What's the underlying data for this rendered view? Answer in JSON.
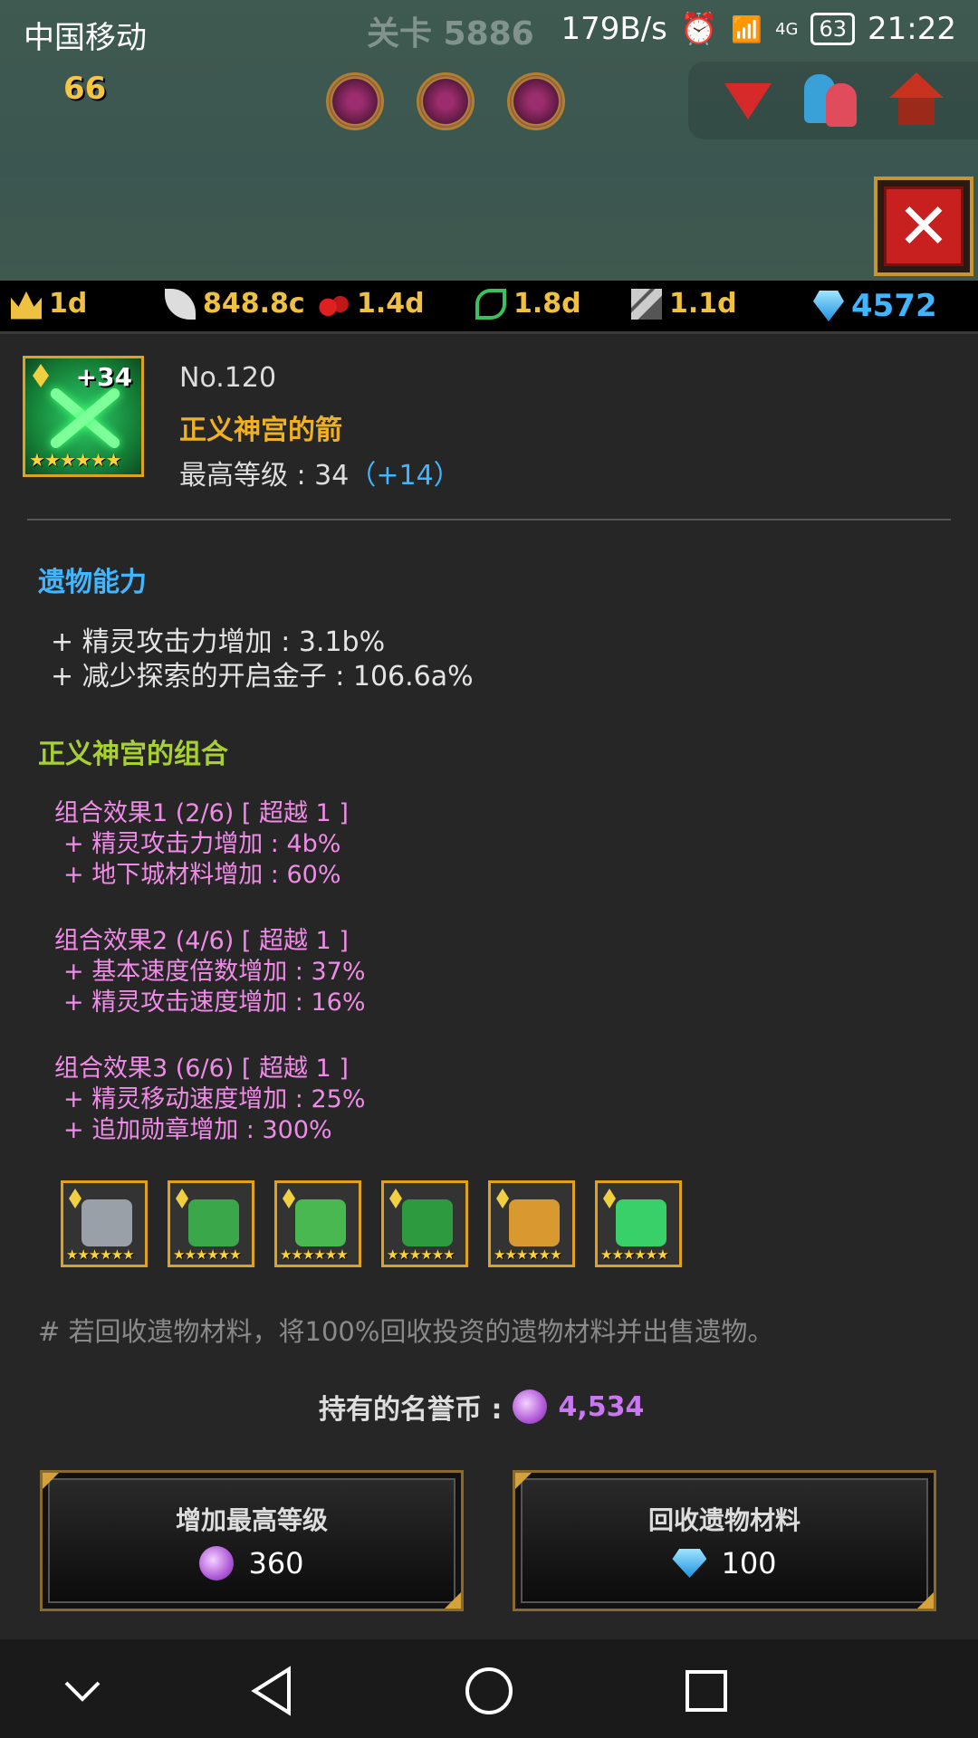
{
  "status_bar": {
    "carrier": "中国移动",
    "net_speed": "179B/s",
    "network": "4G",
    "battery": "63",
    "time": "21:22"
  },
  "game_header": {
    "stage_label": "关卡 5886",
    "level_badge": "66",
    "close_label": "✕"
  },
  "currency_bar": [
    {
      "icon": "crown-icon",
      "value": "1d"
    },
    {
      "icon": "feather-icon",
      "value": "848.8c"
    },
    {
      "icon": "berries-icon",
      "value": "1.4d"
    },
    {
      "icon": "vine-icon",
      "value": "1.8d"
    },
    {
      "icon": "claw-icon",
      "value": "1.1d"
    },
    {
      "icon": "gem-icon",
      "value": "4572"
    }
  ],
  "relic": {
    "plus_level": "+34",
    "number": "No.120",
    "name": "正义神宫的箭",
    "max_level_label": "最高等级 : 34",
    "max_level_bonus": "（+14）",
    "stars": "★★★★★★"
  },
  "ability": {
    "title": "遗物能力",
    "lines": [
      "+ 精灵攻击力增加 : 3.1b%",
      "+ 减少探索的开启金子 : 106.6a%"
    ]
  },
  "set": {
    "title": "正义神宫的组合",
    "effects": [
      {
        "head": "组合效果1 (2/6) [ 超越 1 ]",
        "lines": [
          "+ 精灵攻击力增加 : 4b%",
          "+ 地下城材料增加 : 60%"
        ]
      },
      {
        "head": "组合效果2 (4/6) [ 超越 1 ]",
        "lines": [
          "+ 基本速度倍数增加 : 37%",
          "+ 精灵攻击速度增加 : 16%"
        ]
      },
      {
        "head": "组合效果3 (6/6) [ 超越 1 ]",
        "lines": [
          "+ 精灵移动速度增加 : 25%",
          "+ 追加勋章增加 : 300%"
        ]
      }
    ],
    "items": [
      {
        "name": "bow-relic",
        "color": "#9aa0a8"
      },
      {
        "name": "helmet-relic",
        "color": "#3aa84a"
      },
      {
        "name": "armor-relic",
        "color": "#4ab850"
      },
      {
        "name": "boots-relic",
        "color": "#2e9a40"
      },
      {
        "name": "gold-helm-relic",
        "color": "#d89a30"
      },
      {
        "name": "arrow-relic",
        "color": "#38d068"
      }
    ]
  },
  "recycle_note": "# 若回收遗物材料，将100%回收投资的遗物材料并出售遗物。",
  "honor": {
    "label": "持有的名誉币 :",
    "amount": "4,534"
  },
  "buttons": {
    "increase_level": {
      "label": "增加最高等级",
      "cost": "360"
    },
    "recycle": {
      "label": "回收遗物材料",
      "cost": "100"
    }
  },
  "colors": {
    "accent_blue": "#3fb6ff",
    "relic_name_orange": "#f0b020",
    "set_title_green": "#a8d030",
    "combo_pink": "#f08ce8",
    "honor_purple": "#c978f2"
  }
}
